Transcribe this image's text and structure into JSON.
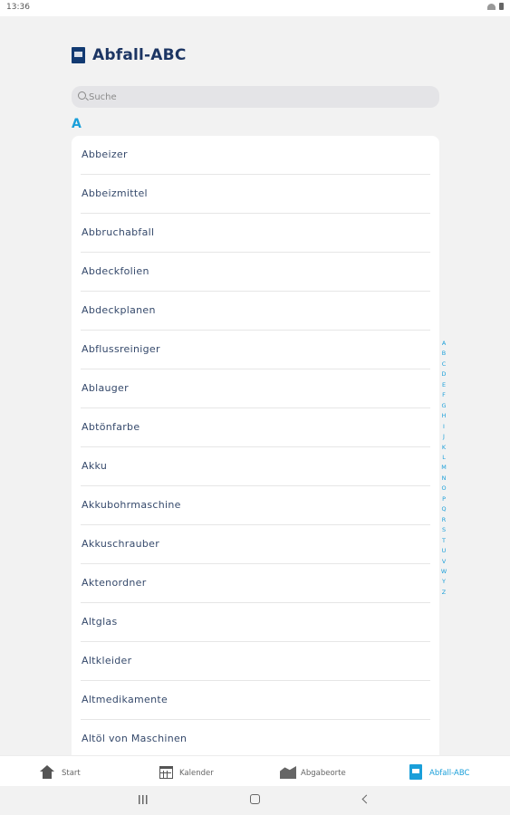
{
  "status_bar": {
    "time": "13:36"
  },
  "header": {
    "title": "Abfall-ABC"
  },
  "search": {
    "placeholder": "Suche",
    "value": ""
  },
  "section": {
    "letter": "A"
  },
  "items": [
    "Abbeizer",
    "Abbeizmittel",
    "Abbruchabfall",
    "Abdeckfolien",
    "Abdeckplanen",
    "Abflussreiniger",
    "Ablauger",
    "Abtönfarbe",
    "Akku",
    "Akkubohrmaschine",
    "Akkuschrauber",
    "Aktenordner",
    "Altglas",
    "Altkleider",
    "Altmedikamente",
    "Altöl von Maschinen"
  ],
  "alphabet": [
    "A",
    "B",
    "C",
    "D",
    "E",
    "F",
    "G",
    "H",
    "I",
    "J",
    "K",
    "L",
    "M",
    "N",
    "O",
    "P",
    "Q",
    "R",
    "S",
    "T",
    "U",
    "V",
    "W",
    "Y",
    "Z"
  ],
  "bottom_nav": {
    "start": "Start",
    "kalender": "Kalender",
    "abgabeorte": "Abgabeorte",
    "abfall_abc": "Abfall-ABC"
  },
  "colors": {
    "accent": "#1a9fd9",
    "brand": "#123a72",
    "text": "#35496b"
  },
  "icons": {
    "app_logo": "app-logo-icon",
    "search": "search-icon",
    "home": "home-icon",
    "calendar": "calendar-icon",
    "places": "drop-off-places-icon",
    "abc": "abc-book-icon"
  }
}
